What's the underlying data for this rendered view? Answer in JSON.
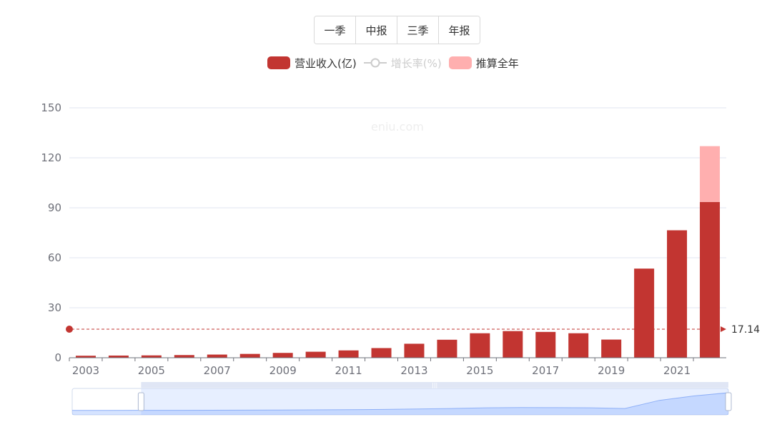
{
  "periods": {
    "q1": "一季",
    "h1": "中报",
    "q3": "三季",
    "annual": "年报"
  },
  "legend": {
    "revenue": "营业收入(亿)",
    "growth": "增长率(%)",
    "estimate": "推算全年"
  },
  "watermark": "eniu.com",
  "colors": {
    "revenue": "#c23531",
    "estimate": "#ffafaf",
    "growth_off": "#cccccc",
    "grid": "#e0e6f1",
    "axis_text": "#6e7079"
  },
  "chart_data": {
    "type": "bar",
    "categories": [
      "2003",
      "2004",
      "2005",
      "2006",
      "2007",
      "2008",
      "2009",
      "2010",
      "2011",
      "2012",
      "2013",
      "2014",
      "2015",
      "2016",
      "2017",
      "2018",
      "2019",
      "2020",
      "2021",
      "2022"
    ],
    "x_tick_labels": [
      "2003",
      "2005",
      "2007",
      "2009",
      "2011",
      "2013",
      "2015",
      "2017",
      "2019",
      "2021"
    ],
    "series": [
      {
        "name": "营业收入(亿)",
        "values": [
          1.2,
          1.3,
          1.4,
          1.6,
          1.9,
          2.3,
          2.9,
          3.6,
          4.4,
          5.8,
          8.4,
          10.8,
          14.7,
          16.0,
          15.5,
          14.7,
          10.9,
          53.5,
          76.5,
          93.5
        ]
      },
      {
        "name": "推算全年",
        "values": [
          0,
          0,
          0,
          0,
          0,
          0,
          0,
          0,
          0,
          0,
          0,
          0,
          0,
          0,
          0,
          0,
          0,
          0,
          0,
          33.5
        ]
      }
    ],
    "average_line": {
      "value": 17.14,
      "label": "17.14"
    },
    "ylim": [
      0,
      150
    ],
    "y_ticks": [
      0,
      30,
      60,
      90,
      120,
      150
    ],
    "grid": true,
    "legend_position": "top-center",
    "zoom_window": [
      0.105,
      1.0
    ]
  }
}
